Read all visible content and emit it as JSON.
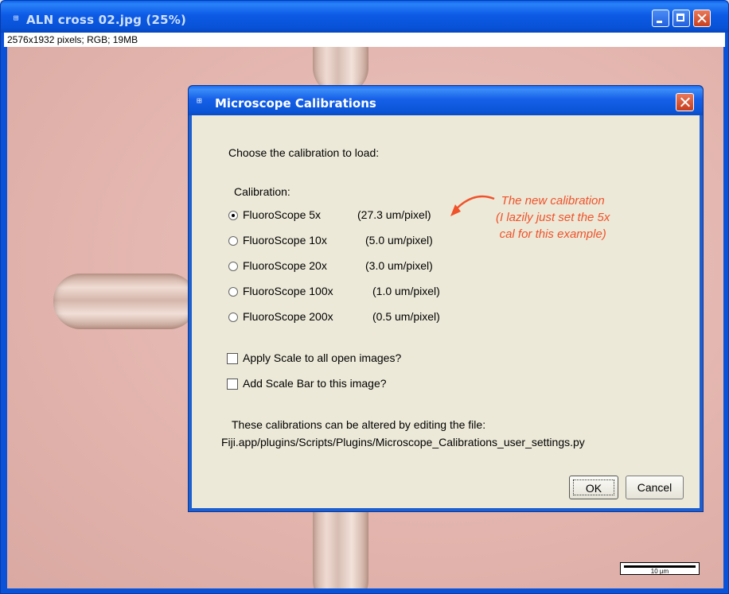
{
  "image_window": {
    "title": "ALN cross 02.jpg (25%)",
    "info": "2576x1932 pixels; RGB; 19MB",
    "scale_bar_label": "10 µm"
  },
  "dialog": {
    "title": "Microscope Calibrations",
    "prompt": "Choose the calibration to load:",
    "group_label": "Calibration:",
    "options": [
      {
        "name": "FluoroScope 5x",
        "value": "(27.3 um/pixel)",
        "selected": true
      },
      {
        "name": "FluoroScope 10x",
        "value": "(5.0 um/pixel)",
        "selected": false
      },
      {
        "name": "FluoroScope 20x",
        "value": "(3.0 um/pixel)",
        "selected": false
      },
      {
        "name": "FluoroScope 100x",
        "value": "(1.0 um/pixel)",
        "selected": false
      },
      {
        "name": "FluoroScope 200x",
        "value": "(0.5 um/pixel)",
        "selected": false
      }
    ],
    "checkboxes": [
      {
        "label": "Apply Scale to all open images?",
        "checked": false
      },
      {
        "label": "Add Scale Bar to this image?",
        "checked": false
      }
    ],
    "footer_line1": "These calibrations can be altered by editing the file:",
    "footer_line2": "Fiji.app/plugins/Scripts/Plugins/Microscope_Calibrations_user_settings.py",
    "ok_label": "OK",
    "cancel_label": "Cancel"
  },
  "annotation": {
    "line1": "The new calibration",
    "line2": "(I lazily just set the 5x",
    "line3": "cal for this example)",
    "color": "#f0522a"
  },
  "icons": {
    "app_icon": "imagej-icon",
    "minimize": "minimize-icon",
    "maximize": "maximize-icon",
    "close": "close-icon"
  }
}
